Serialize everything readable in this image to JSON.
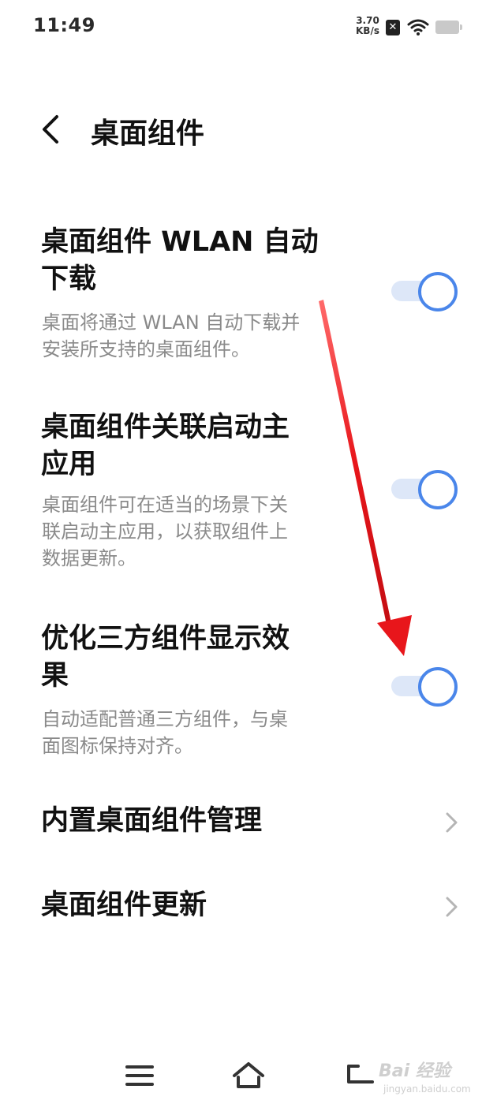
{
  "status_bar": {
    "time": "11:49",
    "net_speed_value": "3.70",
    "net_speed_unit": "KB/s",
    "sim_icon": "no-sim-icon",
    "wifi_icon": "wifi-icon",
    "battery_icon": "battery-icon"
  },
  "header": {
    "title": "桌面组件",
    "back_icon": "chevron-left-icon"
  },
  "settings": [
    {
      "title_line1": "桌面组件 WLAN 自动",
      "title_line2": "下载",
      "description_line1": "桌面将通过 WLAN 自动下载并",
      "description_line2": "安装所支持的桌面组件。",
      "enabled": true
    },
    {
      "title_line1": "桌面组件关联启动主",
      "title_line2": "应用",
      "description_line1": "桌面组件可在适当的场景下关",
      "description_line2": "联启动主应用，以获取组件上",
      "description_line3": "数据更新。",
      "enabled": true
    },
    {
      "title_line1": "优化三方组件显示效",
      "title_line2": "果",
      "description_line1": "自动适配普通三方组件，与桌",
      "description_line2": "面图标保持对齐。",
      "enabled": true
    }
  ],
  "nav_items": [
    {
      "label": "内置桌面组件管理",
      "icon": "chevron-right-icon"
    },
    {
      "label": "桌面组件更新",
      "icon": "chevron-right-icon"
    }
  ],
  "bottom_nav": {
    "menu_icon": "menu-icon",
    "home_icon": "home-icon",
    "back_icon": "back-icon"
  },
  "watermark": {
    "text": "Bai 经验",
    "url": "jingyan.baidu.com"
  },
  "colors": {
    "accent": "#4a86ea",
    "toggle_track": "#dde7f8",
    "annotation_arrow": "#e8161b"
  }
}
